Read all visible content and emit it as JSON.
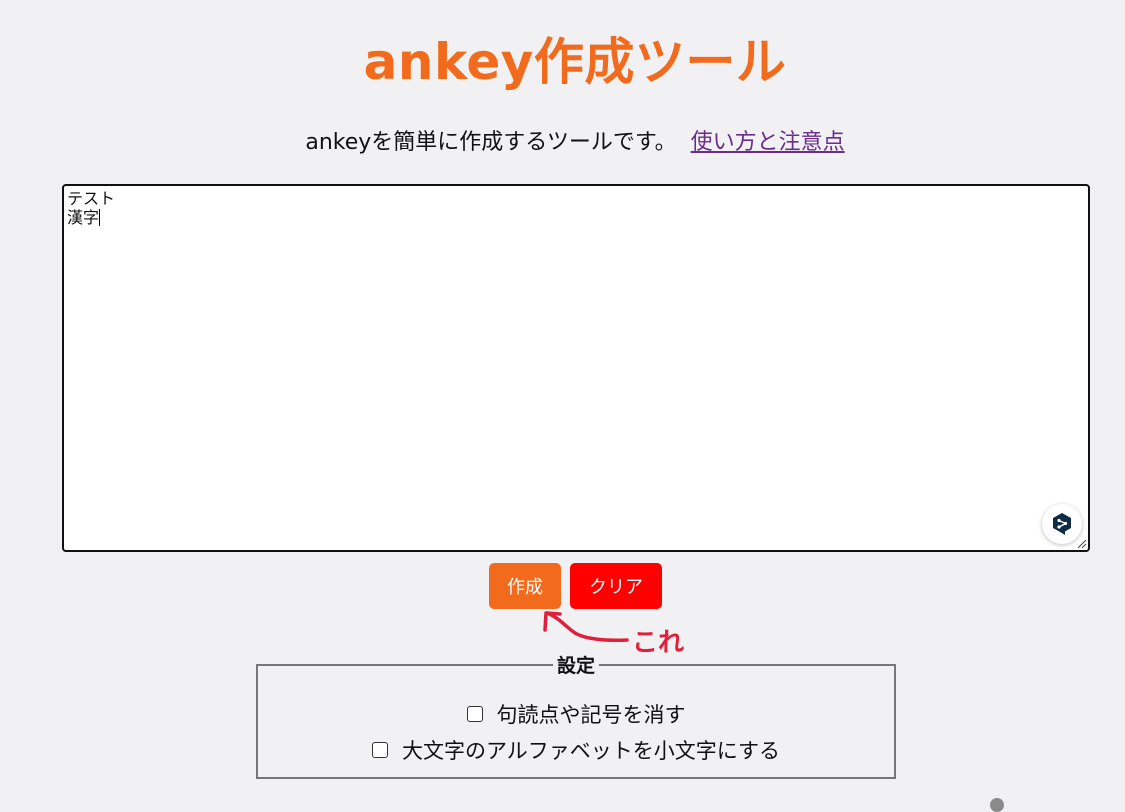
{
  "page": {
    "title": "ankey作成ツール",
    "intro": "ankeyを簡単に作成するツールです。",
    "help_link": "使い方と注意点"
  },
  "editor": {
    "lines": [
      "テスト",
      "漢字"
    ],
    "assistant_icon": "deepl-icon"
  },
  "buttons": {
    "create": "作成",
    "clear": "クリア"
  },
  "annotation": {
    "label": "これ",
    "color": "#e0203a"
  },
  "settings": {
    "legend": "設定",
    "options": [
      {
        "label": "句読点や記号を消す",
        "checked": false
      },
      {
        "label": "大文字のアルファベットを小文字にする",
        "checked": false
      }
    ]
  },
  "colors": {
    "accent": "#f26a1b",
    "clear": "#ff0000",
    "link": "#6a2d8f",
    "background": "#f1f1f3"
  }
}
